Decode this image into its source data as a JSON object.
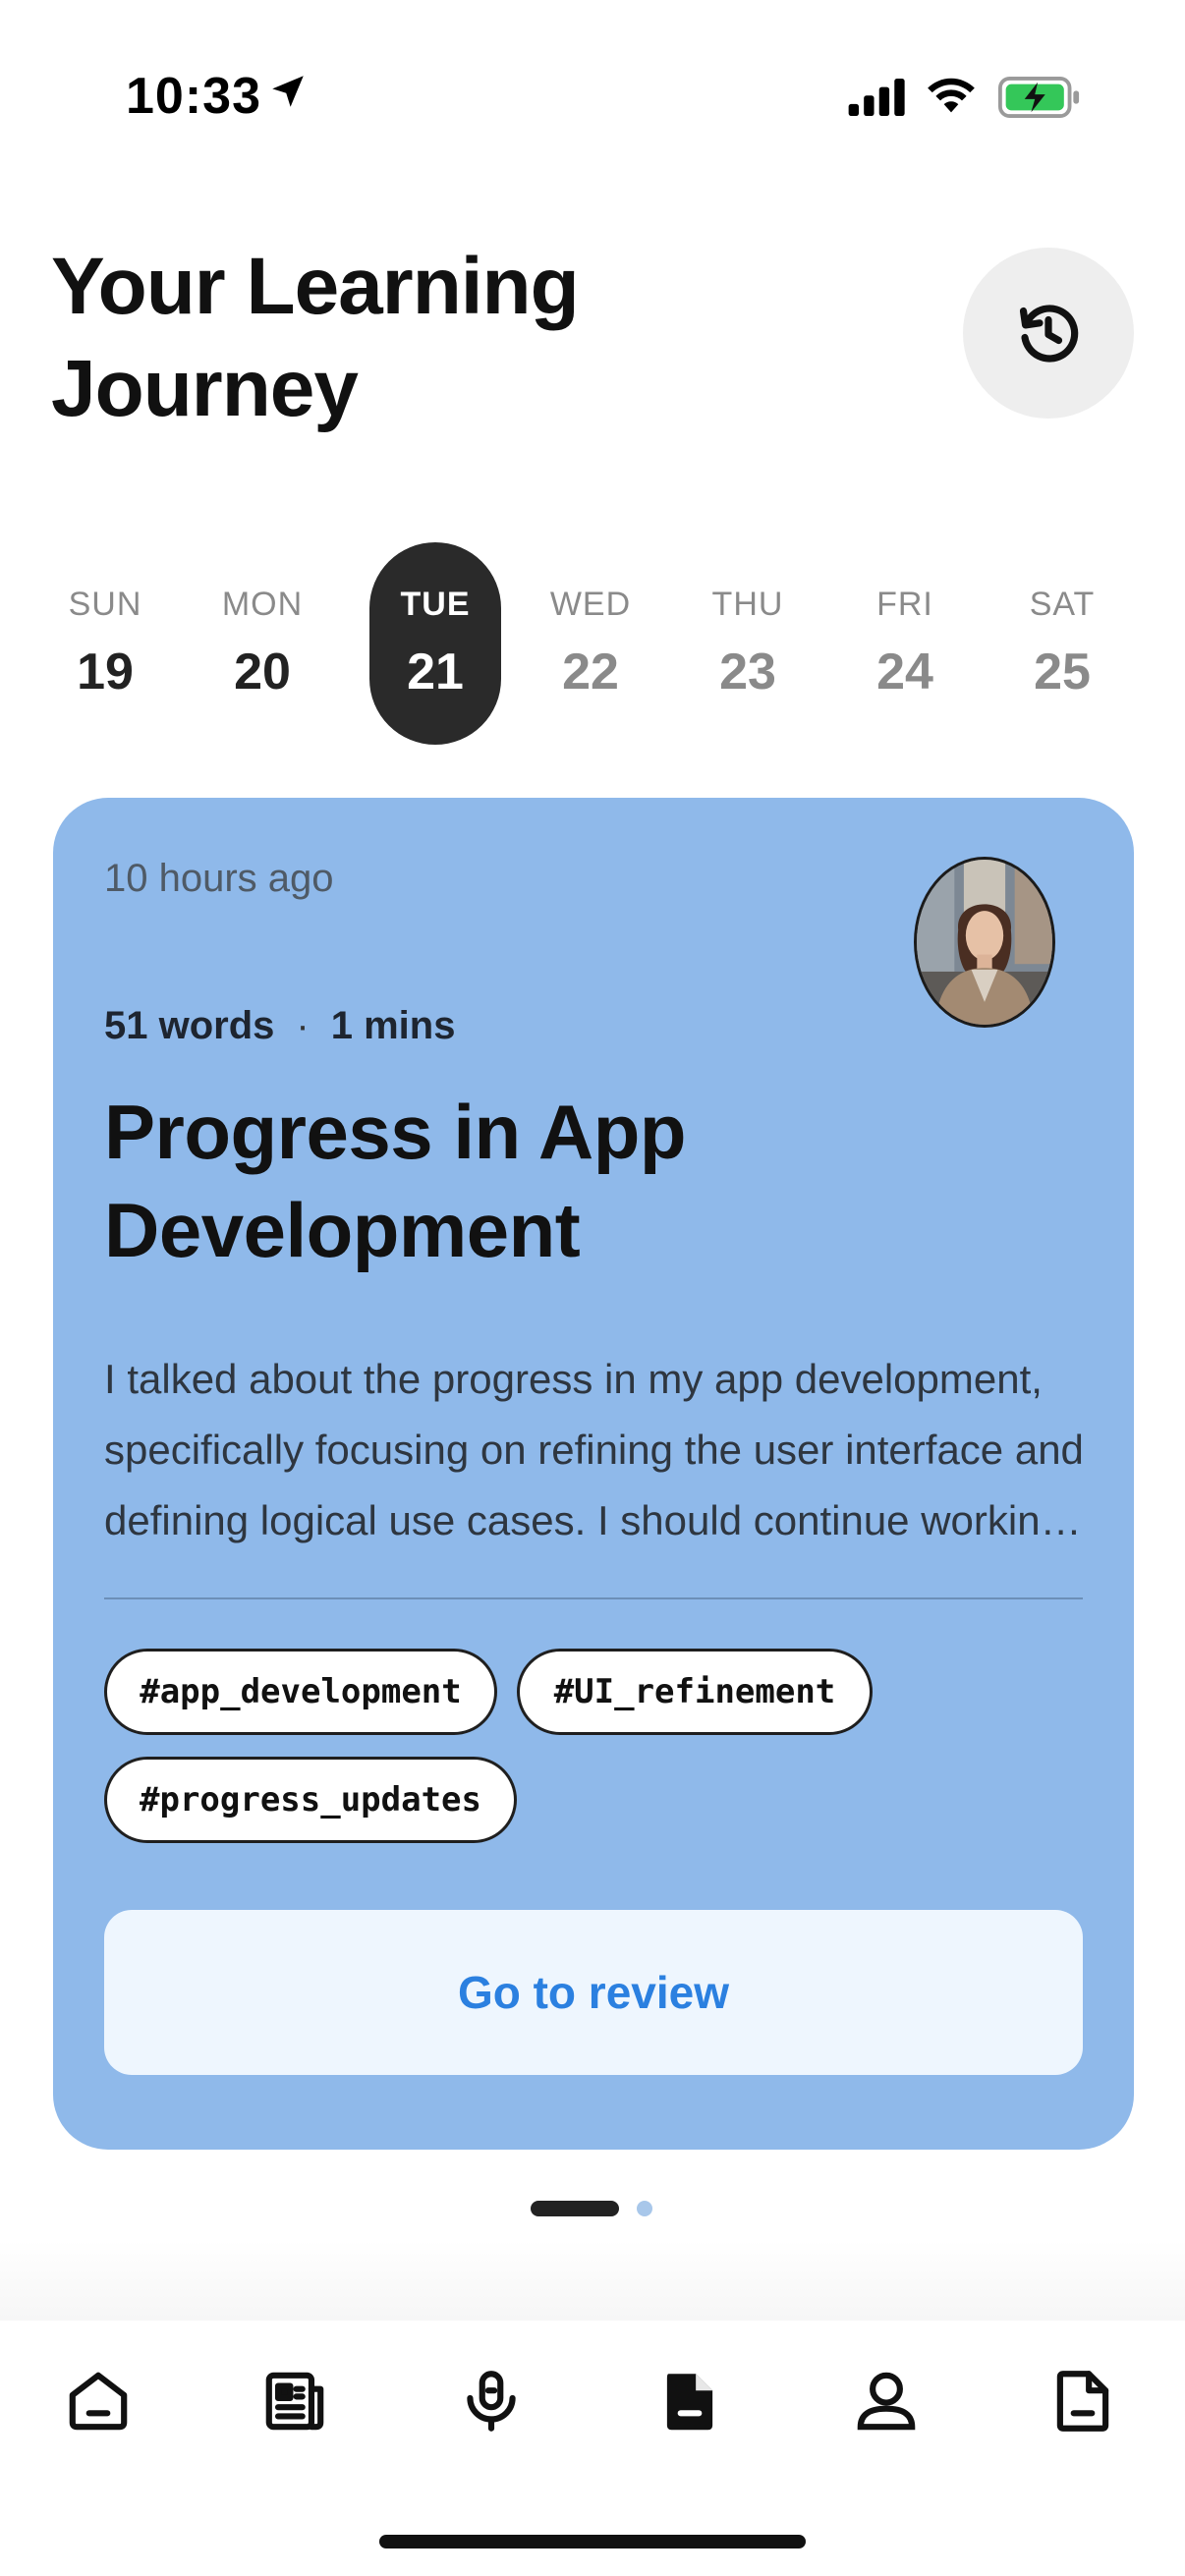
{
  "status_bar": {
    "time": "10:33",
    "icons": [
      "location-arrow-icon",
      "cellular-signal-icon",
      "wifi-icon",
      "battery-charging-icon"
    ],
    "battery_color": "#34c759"
  },
  "header": {
    "title": "Your Learning Journey",
    "history_icon": "history-icon"
  },
  "week": {
    "days": [
      {
        "name": "SUN",
        "number": "19",
        "state": "past"
      },
      {
        "name": "MON",
        "number": "20",
        "state": "past"
      },
      {
        "name": "TUE",
        "number": "21",
        "state": "selected"
      },
      {
        "name": "WED",
        "number": "22",
        "state": "future"
      },
      {
        "name": "THU",
        "number": "23",
        "state": "future"
      },
      {
        "name": "FRI",
        "number": "24",
        "state": "future"
      },
      {
        "name": "SAT",
        "number": "25",
        "state": "future"
      }
    ]
  },
  "card": {
    "background": "#8fb9ea",
    "time_ago": "10 hours ago",
    "word_count": "51 words",
    "separator": "·",
    "duration": "1 mins",
    "title": "Progress in App Development",
    "summary": "I talked about the progress in my app development, specifically focusing on refining the user interface and defining logical use cases. I should continue working on the details and share updates soon.",
    "tags": [
      "#app_development",
      "#UI_refinement",
      "#progress_updates"
    ],
    "review_button": "Go to review",
    "accent": "#2b80e0"
  },
  "pager": {
    "current": 1,
    "total": 2
  },
  "bottom_nav": {
    "items": [
      {
        "icon": "home-icon"
      },
      {
        "icon": "newspaper-icon"
      },
      {
        "icon": "microphone-icon"
      },
      {
        "icon": "document-filled-icon",
        "active": true
      },
      {
        "icon": "profile-icon"
      },
      {
        "icon": "document-outline-icon"
      }
    ]
  }
}
